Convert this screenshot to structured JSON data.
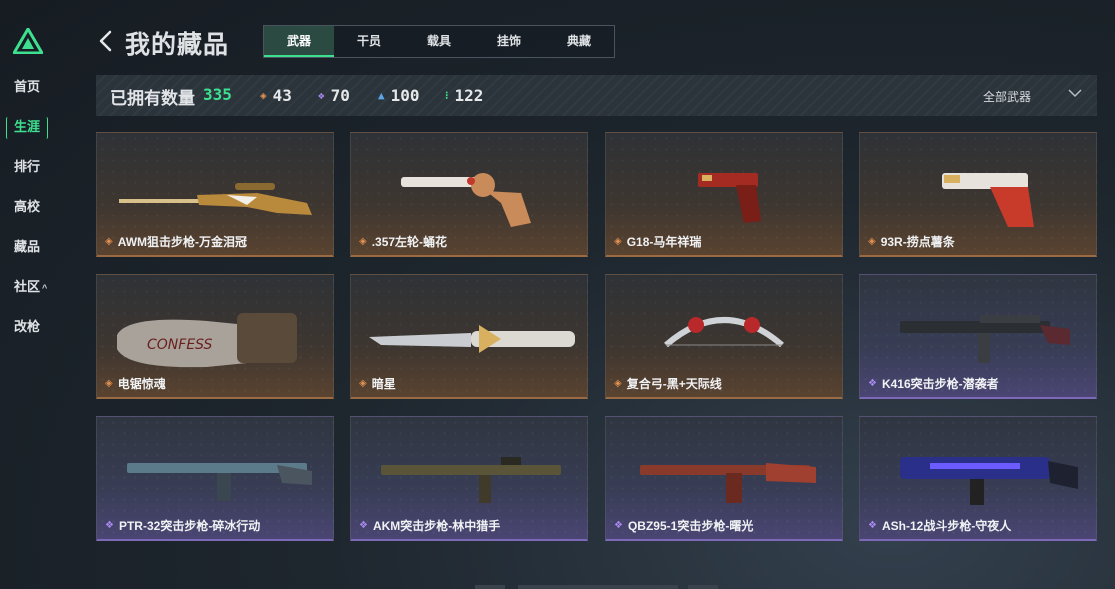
{
  "sidebar": {
    "items": [
      {
        "label": "首页"
      },
      {
        "label": "生涯"
      },
      {
        "label": "排行"
      },
      {
        "label": "高校"
      },
      {
        "label": "藏品"
      },
      {
        "label": "社区",
        "caret": "^"
      },
      {
        "label": "改枪"
      }
    ],
    "active_index": 1
  },
  "header": {
    "title": "我的藏品",
    "tabs": [
      {
        "label": "武器"
      },
      {
        "label": "干员"
      },
      {
        "label": "载具"
      },
      {
        "label": "挂饰"
      },
      {
        "label": "典藏"
      }
    ],
    "active_tab": 0
  },
  "stats": {
    "label": "已拥有数量",
    "total": "335",
    "counts": [
      {
        "icon": "orange-diamond-icon",
        "value": "43",
        "color": "#e39150"
      },
      {
        "icon": "purple-diamond-icon",
        "value": "70",
        "color": "#a98af0"
      },
      {
        "icon": "blue-chevron-icon",
        "value": "100",
        "color": "#5aa6e8"
      },
      {
        "icon": "green-dots-icon",
        "value": "122",
        "color": "#3de08f"
      }
    ],
    "filter": "全部武器"
  },
  "items": [
    {
      "name": "AWM狙击步枪-万金泪冠",
      "rarity": "orange"
    },
    {
      "name": ".357左轮-蛹花",
      "rarity": "orange"
    },
    {
      "name": "G18-马年祥瑞",
      "rarity": "orange"
    },
    {
      "name": "93R-捞点薯条",
      "rarity": "orange"
    },
    {
      "name": "电锯惊魂",
      "rarity": "orange"
    },
    {
      "name": "暗星",
      "rarity": "orange"
    },
    {
      "name": "复合弓-黑+天际线",
      "rarity": "orange"
    },
    {
      "name": "K416突击步枪-潜袭者",
      "rarity": "purple"
    },
    {
      "name": "PTR-32突击步枪-碎冰行动",
      "rarity": "purple"
    },
    {
      "name": "AKM突击步枪-林中猎手",
      "rarity": "purple"
    },
    {
      "name": "QBZ95-1突击步枪-曙光",
      "rarity": "purple"
    },
    {
      "name": "ASh-12战斗步枪-守夜人",
      "rarity": "purple"
    }
  ],
  "colors": {
    "accent": "#3de08f",
    "orange_rarity": "#e39150",
    "purple_rarity": "#a98af0"
  }
}
